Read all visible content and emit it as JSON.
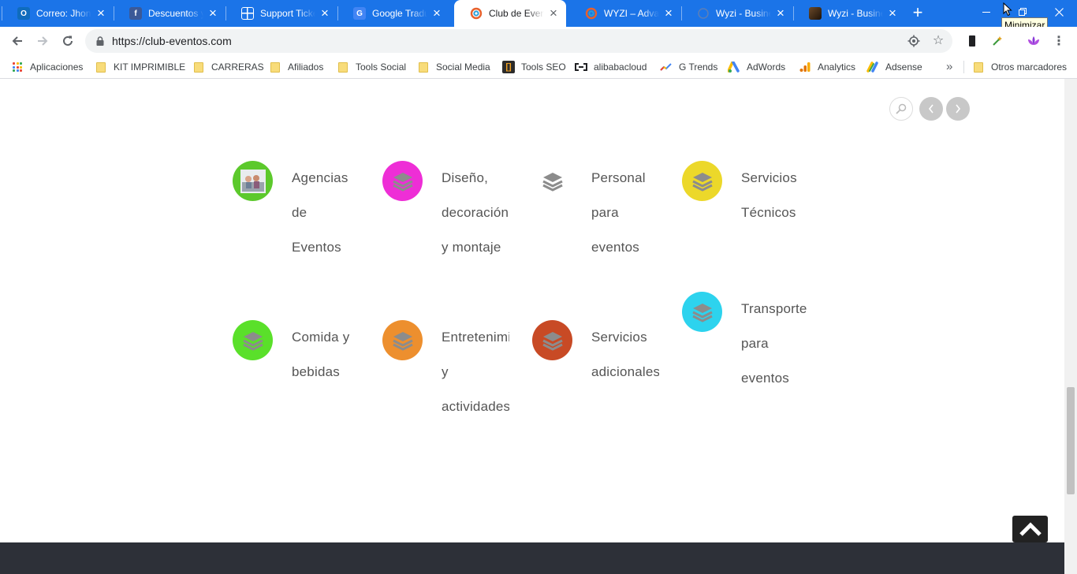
{
  "tabs": [
    {
      "title": "Correo: Jhonatan",
      "favicon": "outlook-icon",
      "active": false
    },
    {
      "title": "Descuentos y Promociones",
      "favicon": "facebook-icon",
      "active": false
    },
    {
      "title": "Support Tickets",
      "favicon": "grid-table-icon",
      "active": false
    },
    {
      "title": "Google Traductor",
      "favicon": "google-translate-icon",
      "active": false
    },
    {
      "title": "Club de Eventos",
      "favicon": "club-eventos-icon",
      "active": true
    },
    {
      "title": "WYZI – Advanced",
      "favicon": "club-eventos-icon",
      "active": false
    },
    {
      "title": "Wyzi - Business",
      "favicon": "globe-icon",
      "active": false
    },
    {
      "title": "Wyzi - Business",
      "favicon": "wyzi-thumb-icon",
      "active": false
    }
  ],
  "window": {
    "tooltip": "Minimizar"
  },
  "address": {
    "url": "https://club-eventos.com"
  },
  "bookmarks": [
    {
      "label": "Aplicaciones",
      "icon": "apps-grid-icon"
    },
    {
      "label": "KIT IMPRIMIBLE",
      "icon": "folder-icon"
    },
    {
      "label": "CARRERAS",
      "icon": "folder-icon"
    },
    {
      "label": "Afiliados",
      "icon": "folder-icon"
    },
    {
      "label": "Tools Social",
      "icon": "folder-icon"
    },
    {
      "label": "Social Media",
      "icon": "folder-icon"
    },
    {
      "label": "Tools SEO",
      "icon": "bracket-icon"
    },
    {
      "label": "alibabacloud",
      "icon": "alibaba-icon"
    },
    {
      "label": "G Trends",
      "icon": "trends-icon"
    },
    {
      "label": "AdWords",
      "icon": "adwords-icon"
    },
    {
      "label": "Analytics",
      "icon": "analytics-icon"
    },
    {
      "label": "Adsense",
      "icon": "adsense-icon"
    }
  ],
  "bookmarks_more": "»",
  "bookmarks_other": "Otros marcadores",
  "categories": [
    {
      "label": "Agencias de Eventos",
      "color": "#5cc92c",
      "icon": "photo-thumbnail-icon"
    },
    {
      "label": "Diseño, decoración y montaje",
      "color": "#ee2ed6",
      "icon": "layers-icon"
    },
    {
      "label": "Personal para eventos",
      "color": "#ffffff",
      "icon": "layers-icon"
    },
    {
      "label": "Servicios Técnicos",
      "color": "#ecd82a",
      "icon": "layers-icon"
    },
    {
      "label": "Comida y bebidas",
      "color": "#5ae02a",
      "icon": "layers-icon"
    },
    {
      "label": "Entretenimiento y actividades",
      "color": "#ed8f2e",
      "icon": "layers-icon"
    },
    {
      "label": "Servicios adicionales",
      "color": "#c84a25",
      "icon": "layers-icon"
    },
    {
      "label": "Transporte para eventos",
      "color": "#2dd3ee",
      "icon": "layers-icon"
    }
  ],
  "colors": {
    "chrome_blue": "#1b74e8",
    "footer": "#2d3038",
    "label_text": "#555555"
  }
}
